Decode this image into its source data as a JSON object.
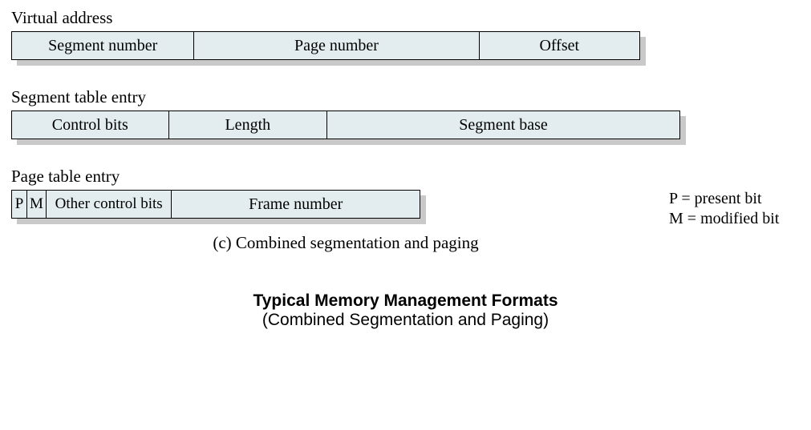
{
  "sections": {
    "virtual_address": {
      "label": "Virtual address",
      "fields": {
        "segment_number": "Segment number",
        "page_number": "Page number",
        "offset": "Offset"
      }
    },
    "segment_table_entry": {
      "label": "Segment table entry",
      "fields": {
        "control_bits": "Control bits",
        "length": "Length",
        "segment_base": "Segment base"
      }
    },
    "page_table_entry": {
      "label": "Page table entry",
      "fields": {
        "p": "P",
        "m": "M",
        "other_control_bits": "Other control bits",
        "frame_number": "Frame number"
      }
    }
  },
  "legend": {
    "p": "P  = present bit",
    "m": "M = modified bit"
  },
  "caption_c": "(c) Combined segmentation and paging",
  "bottom": {
    "title": "Typical Memory Management Formats",
    "subtitle": "(Combined Segmentation and Paging)"
  }
}
